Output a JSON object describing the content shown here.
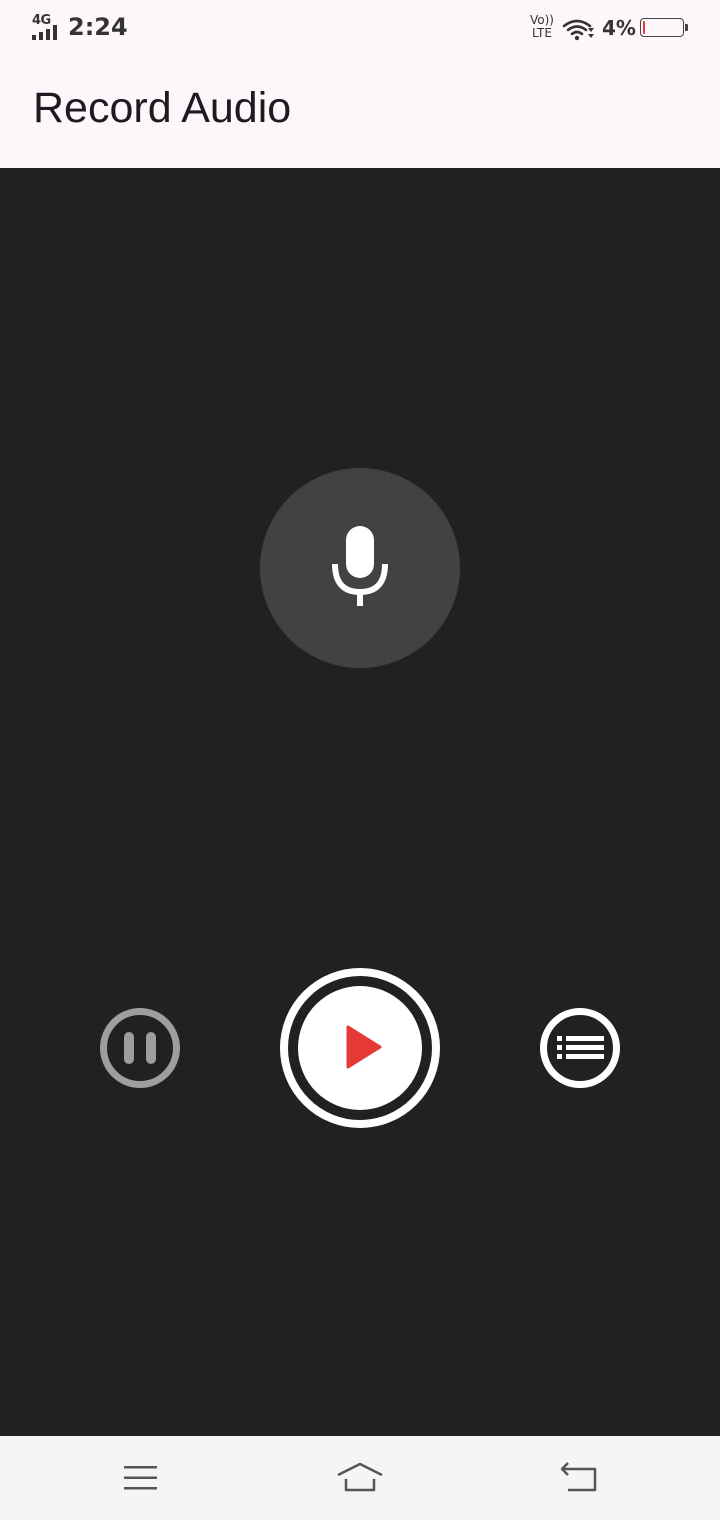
{
  "status_bar": {
    "network_type": "4G",
    "time": "2:24",
    "volte_line1": "Vo))",
    "volte_line2": "LTE",
    "battery_percent": "4%",
    "battery_level": 0.04,
    "battery_color": "#e53935"
  },
  "app_bar": {
    "title": "Record Audio"
  },
  "main": {
    "mic_icon": "microphone-icon",
    "pause_icon": "pause-icon",
    "play_icon": "play-icon",
    "play_icon_color": "#e53935",
    "list_icon": "list-icon"
  },
  "nav_bar": {
    "items": [
      "menu-icon",
      "home-icon",
      "back-icon"
    ]
  },
  "colors": {
    "background": "#212121",
    "app_bar_bg": "#fdf7fc",
    "mic_circle": "#424242",
    "disabled": "#9e9e9e",
    "accent": "#e53935"
  }
}
